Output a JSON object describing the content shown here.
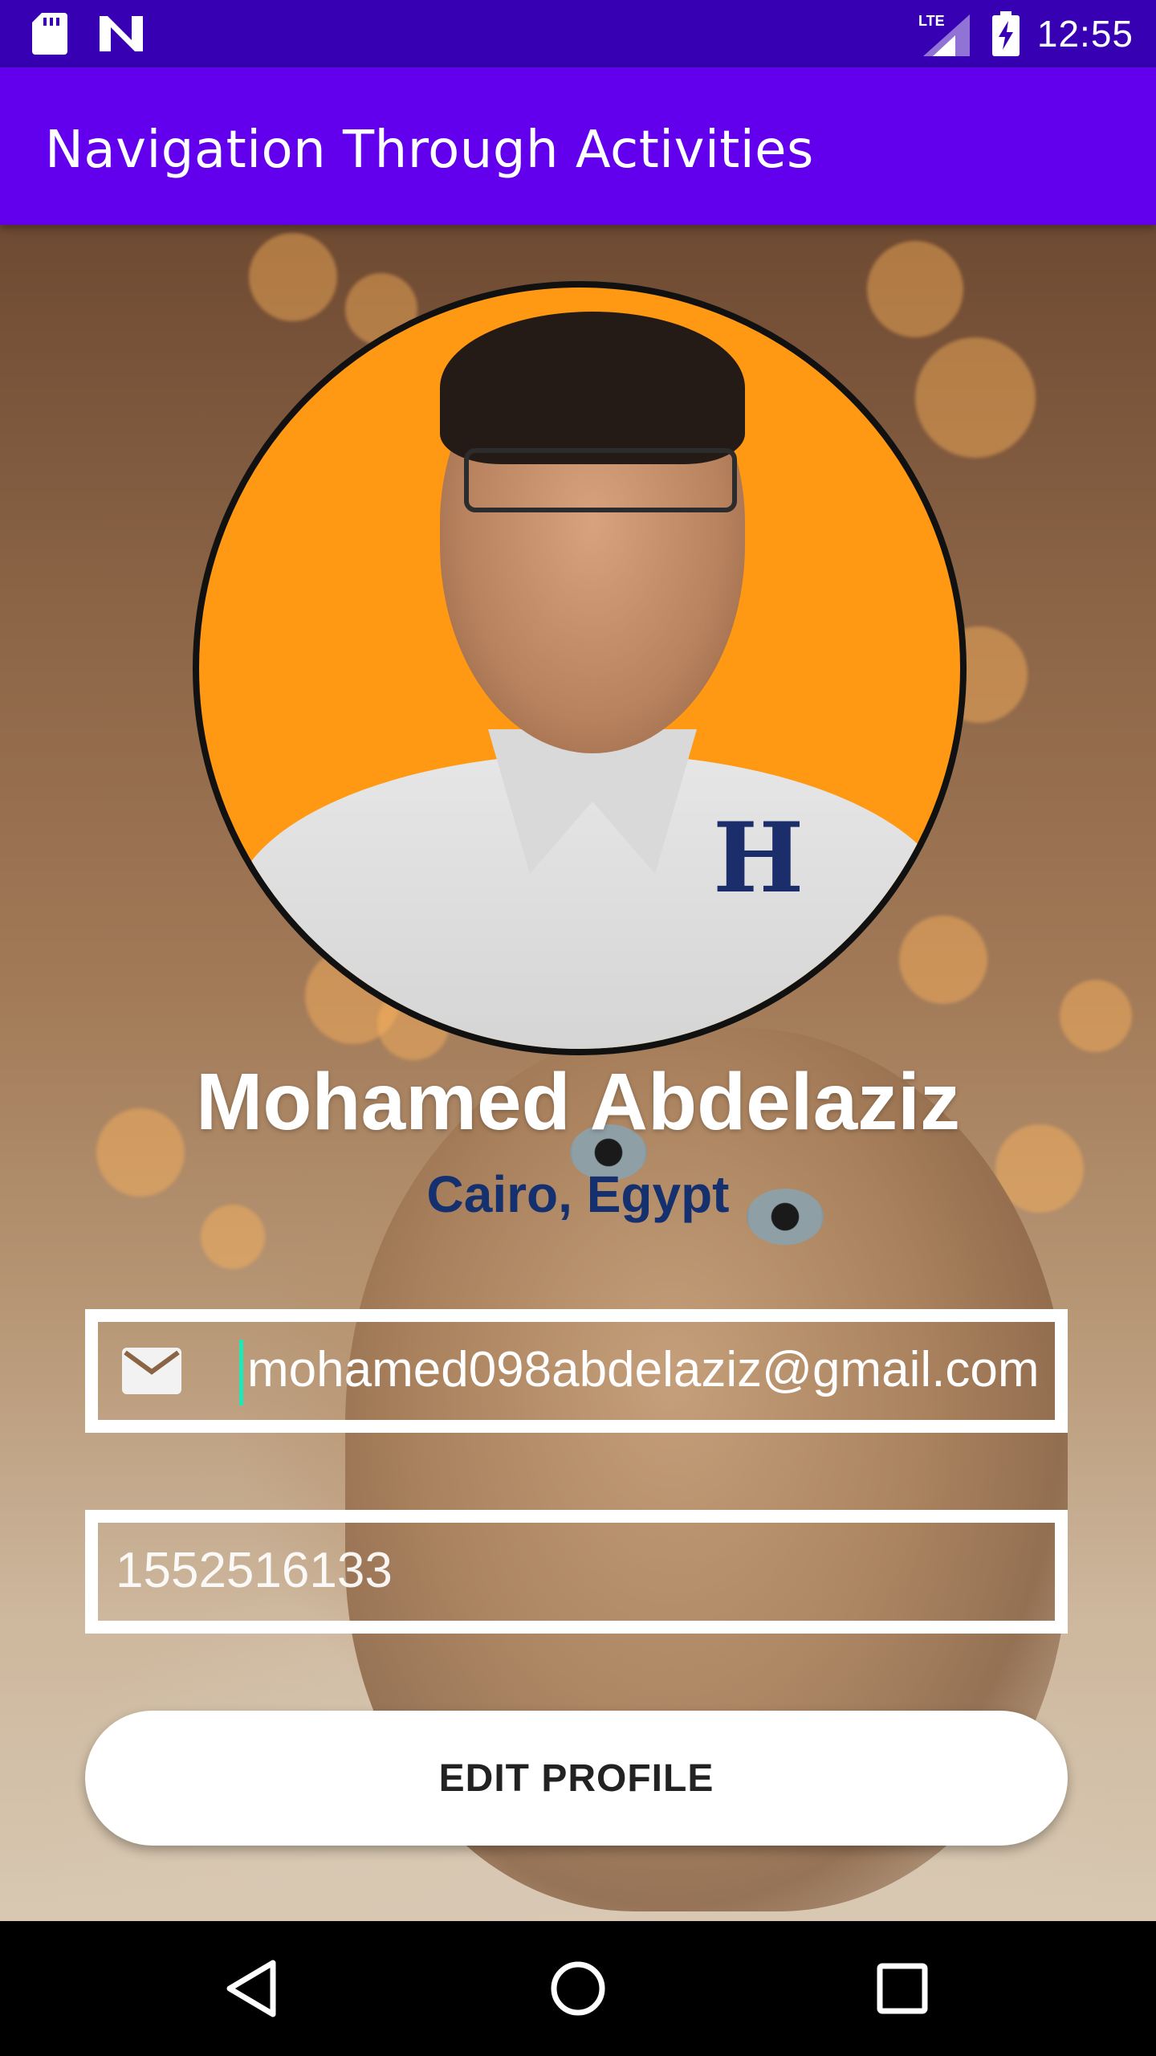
{
  "status_bar": {
    "time": "12:55",
    "network_label": "LTE",
    "icons": [
      "sd-card-icon",
      "n-notification-icon",
      "lte-signal-icon",
      "battery-charging-icon"
    ]
  },
  "app_bar": {
    "title": "Navigation Through Activities",
    "color": "#6200ee"
  },
  "profile": {
    "name": "Mohamed Abdelaziz",
    "location": "Cairo, Egypt",
    "email_value": "mohamed098abdelaziz@gmail.com",
    "phone_value": "1552516133"
  },
  "actions": {
    "edit_label": "EDIT PROFILE"
  },
  "nav_bar": {
    "icons": [
      "back-triangle-icon",
      "home-circle-icon",
      "recents-square-icon"
    ]
  },
  "colors": {
    "status_bar": "#3700b3",
    "accent_cursor": "#1de9b6",
    "location_text": "#14306e",
    "photo_bg": "#ff9812"
  }
}
